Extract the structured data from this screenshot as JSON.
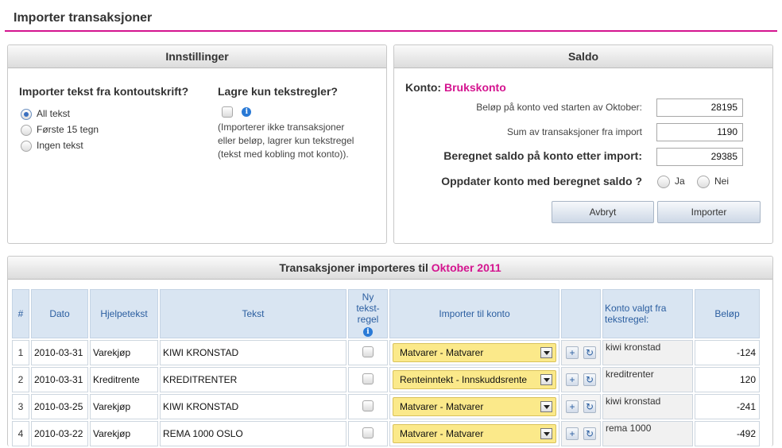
{
  "header": {
    "title": "Importer transaksjoner"
  },
  "settings": {
    "title": "Innstillinger",
    "import_question": "Importer tekst fra kontoutskrift?",
    "options": [
      "All tekst",
      "Første 15 tegn",
      "Ingen tekst"
    ],
    "selected_option": "All tekst",
    "rules_question": "Lagre kun tekstregler?",
    "rules_note_1": "(Importerer ikke transaksjoner",
    "rules_note_2": "eller beløp, lagrer kun tekstregel",
    "rules_note_3": "(tekst med kobling mot konto))."
  },
  "saldo": {
    "title": "Saldo",
    "konto_label": "Konto:",
    "konto_name": "Brukskonto",
    "start_label": "Beløp på konto ved starten av Oktober:",
    "start_value": "28195",
    "sum_label": "Sum av transaksjoner fra import",
    "sum_value": "1190",
    "calc_label": "Beregnet saldo på konto etter import:",
    "calc_value": "29385",
    "update_label": "Oppdater konto med beregnet saldo ?",
    "yes": "Ja",
    "no": "Nei",
    "cancel": "Avbryt",
    "import": "Importer"
  },
  "transactions": {
    "title_prefix": "Transaksjoner importeres til",
    "title_period": "Oktober 2011",
    "columns": {
      "num": "#",
      "date": "Dato",
      "help": "Hjelpetekst",
      "text": "Tekst",
      "new_rule_1": "Ny",
      "new_rule_2": "tekst-",
      "new_rule_3": "regel",
      "import_to": "Importer til konto",
      "rule_account_1": "Konto valgt fra",
      "rule_account_2": "tekstregel:",
      "amount": "Beløp"
    },
    "rows": [
      {
        "num": "1",
        "date": "2010-03-31",
        "help": "Varekjøp",
        "text": "KIWI KRONSTAD",
        "account": "Matvarer - Matvarer",
        "rule": "kiwi kronstad",
        "amount": "-124"
      },
      {
        "num": "2",
        "date": "2010-03-31",
        "help": "Kreditrente",
        "text": "KREDITRENTER",
        "account": "Renteinntekt - Innskuddsrente",
        "rule": "kreditrenter",
        "amount": "120"
      },
      {
        "num": "3",
        "date": "2010-03-25",
        "help": "Varekjøp",
        "text": "KIWI KRONSTAD",
        "account": "Matvarer - Matvarer",
        "rule": "kiwi kronstad",
        "amount": "-241"
      },
      {
        "num": "4",
        "date": "2010-03-22",
        "help": "Varekjøp",
        "text": "REMA 1000 OSLO",
        "account": "Matvarer - Matvarer",
        "rule": "rema 1000",
        "amount": "-492"
      }
    ]
  }
}
